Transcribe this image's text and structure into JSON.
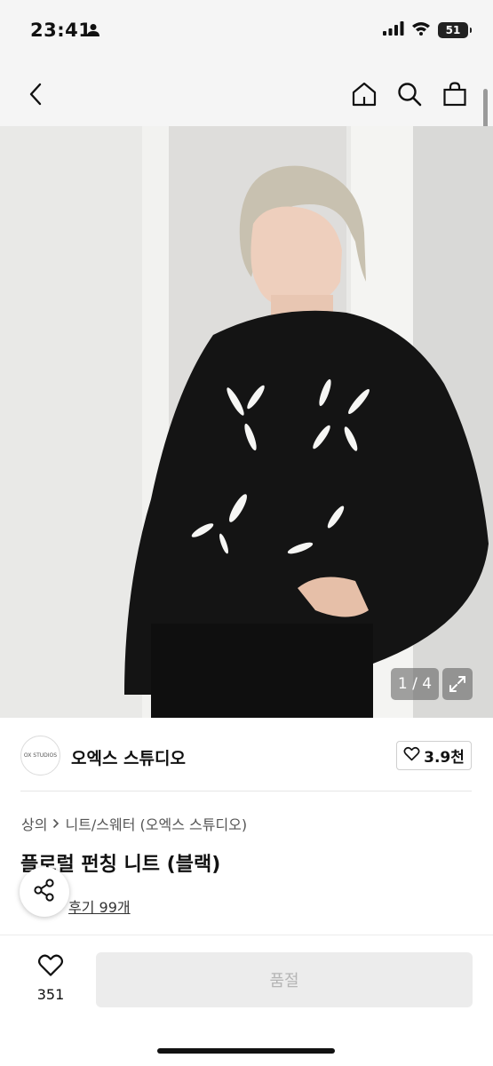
{
  "status_bar": {
    "time": "23:41",
    "battery": "51"
  },
  "nav": {
    "back_icon": "chevron-left-icon",
    "home_icon": "home-icon",
    "search_icon": "search-icon",
    "bag_icon": "shopping-bag-icon"
  },
  "gallery": {
    "counter": "1 / 4"
  },
  "brand": {
    "logo_text": "OX STUDIOS",
    "name": "오엑스 스튜디오",
    "likes": "3.9천"
  },
  "product": {
    "breadcrumb": [
      "상의",
      "니트/스웨터 (오엑스 스튜디오)"
    ],
    "title": "플로럴 펀칭 니트 (블랙)",
    "review_link": "후기 99개"
  },
  "bottom_bar": {
    "wish_count": "351",
    "cta_label": "품절"
  },
  "colors": {
    "accent_star": "#f5b700",
    "disabled_bg": "#ececec",
    "disabled_text": "#b5b5b5"
  }
}
